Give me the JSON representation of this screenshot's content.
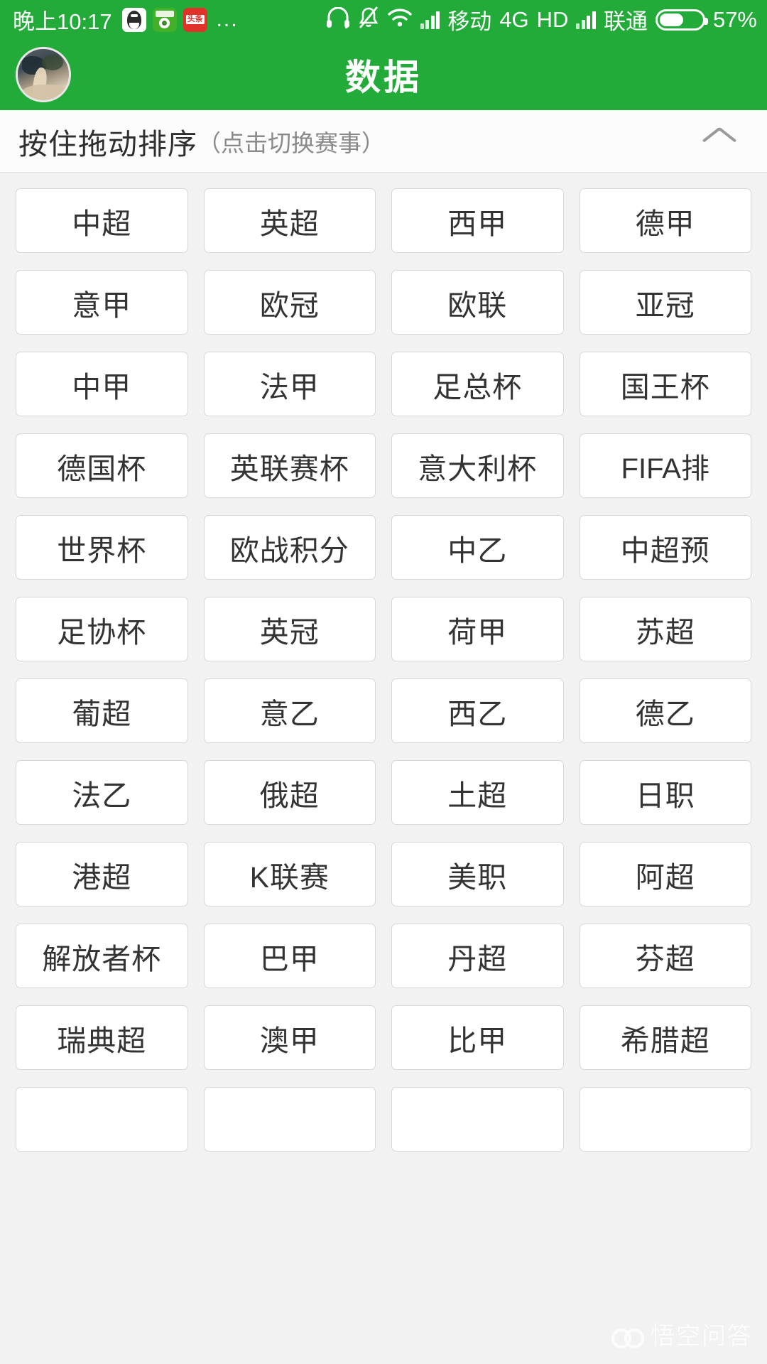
{
  "status_bar": {
    "time": "晚上10:17",
    "app_icons": [
      "qq-icon",
      "football-app-icon",
      "toutiao-icon"
    ],
    "overflow": "...",
    "headset_icon": "headset-icon",
    "silent_icon": "bell-muted-icon",
    "wifi_icon": "wifi-icon",
    "signal1_icon": "signal-bars-icon",
    "carrier1": "移动",
    "network": "4G",
    "hd": "HD",
    "signal2_icon": "signal-bars-icon",
    "carrier2": "联通",
    "battery_icon": "battery-icon",
    "battery_percent": "57%",
    "battery_level": 57,
    "background_color": "#22ab38",
    "text_color": "#ffffff"
  },
  "app_bar": {
    "title": "数据",
    "avatar": "user-avatar",
    "background_color": "#22ab38"
  },
  "sort_header": {
    "main_label": "按住拖动排序",
    "sub_label": "（点击切换赛事）",
    "collapse_icon": "chevron-up-icon"
  },
  "league_grid": {
    "columns": 4,
    "items": [
      "中超",
      "英超",
      "西甲",
      "德甲",
      "意甲",
      "欧冠",
      "欧联",
      "亚冠",
      "中甲",
      "法甲",
      "足总杯",
      "国王杯",
      "德国杯",
      "英联赛杯",
      "意大利杯",
      "FIFA排",
      "世界杯",
      "欧战积分",
      "中乙",
      "中超预",
      "足协杯",
      "英冠",
      "荷甲",
      "苏超",
      "葡超",
      "意乙",
      "西乙",
      "德乙",
      "法乙",
      "俄超",
      "土超",
      "日职",
      "港超",
      "K联赛",
      "美职",
      "阿超",
      "解放者杯",
      "巴甲",
      "丹超",
      "芬超",
      "瑞典超",
      "澳甲",
      "比甲",
      "希腊超",
      "",
      "",
      "",
      ""
    ]
  },
  "watermark": {
    "text": "悟空问答",
    "logo": "wukong-logo-icon"
  },
  "theme": {
    "accent": "#22ab38",
    "page_background": "#f2f2f2",
    "card_background": "#ffffff",
    "card_border": "#d8d8d8",
    "text_primary": "#333333",
    "text_secondary": "#8a8a8a"
  }
}
